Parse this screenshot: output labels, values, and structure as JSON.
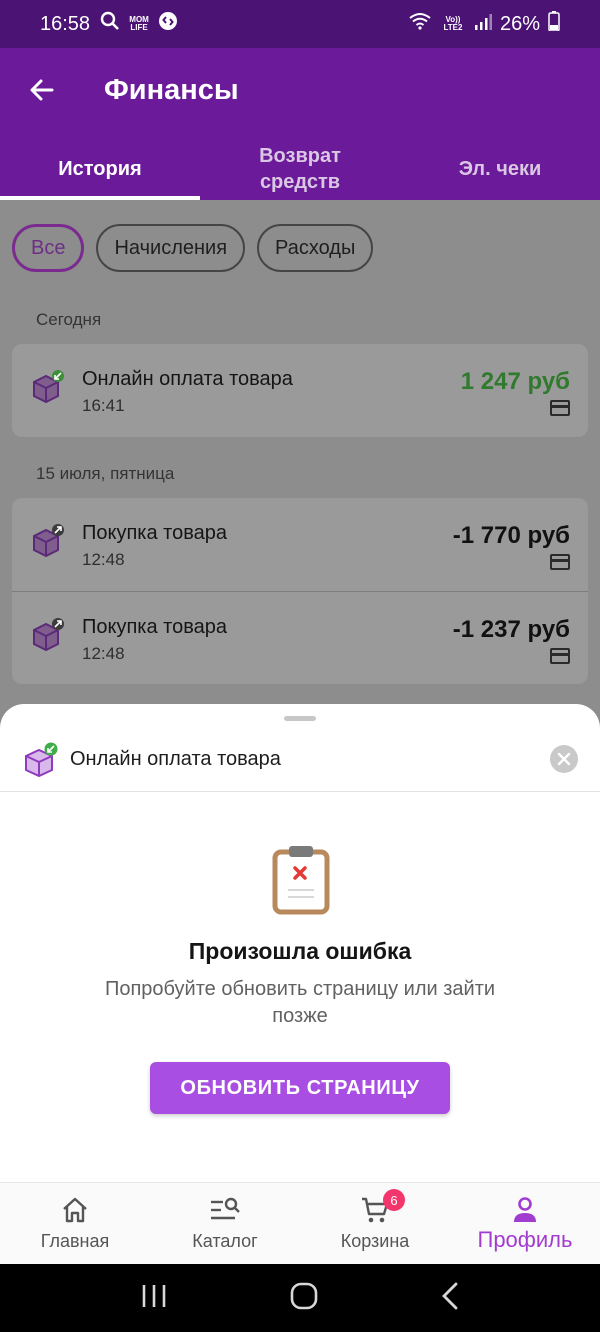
{
  "status_bar": {
    "time": "16:58",
    "mini_badge": "MOM LIFE",
    "volte": "Vo)) LTE2",
    "battery": "26%"
  },
  "header": {
    "title": "Финансы"
  },
  "tabs": [
    {
      "label": "История"
    },
    {
      "label": "Возврат средств"
    },
    {
      "label": "Эл. чеки"
    }
  ],
  "filters": [
    {
      "label": "Все"
    },
    {
      "label": "Начисления"
    },
    {
      "label": "Расходы"
    }
  ],
  "groups": [
    {
      "date": "Сегодня",
      "items": [
        {
          "name": "Онлайн оплата товара",
          "time": "16:41",
          "amount": "1 247 руб"
        }
      ]
    },
    {
      "date": "15 июля, пятница",
      "items": [
        {
          "name": "Покупка товара",
          "time": "12:48",
          "amount": "-1 770 руб"
        },
        {
          "name": "Покупка товара",
          "time": "12:48",
          "amount": "-1 237 руб"
        }
      ]
    }
  ],
  "sheet": {
    "title": "Онлайн оплата товара",
    "error_title": "Произошла ошибка",
    "error_text": "Попробуйте обновить страницу или зайти позже",
    "refresh_label": "ОБНОВИТЬ СТРАНИЦУ"
  },
  "bottom_nav": [
    {
      "label": "Главная",
      "icon": "home-icon"
    },
    {
      "label": "Каталог",
      "icon": "catalog-search-icon"
    },
    {
      "label": "Корзина",
      "icon": "cart-icon",
      "badge": "6"
    },
    {
      "label": "Профиль",
      "icon": "profile-icon"
    }
  ],
  "colors": {
    "accent": "#6b1a99",
    "button": "#a84ee2",
    "income": "#2f7a2c",
    "badge": "#f3366b"
  }
}
